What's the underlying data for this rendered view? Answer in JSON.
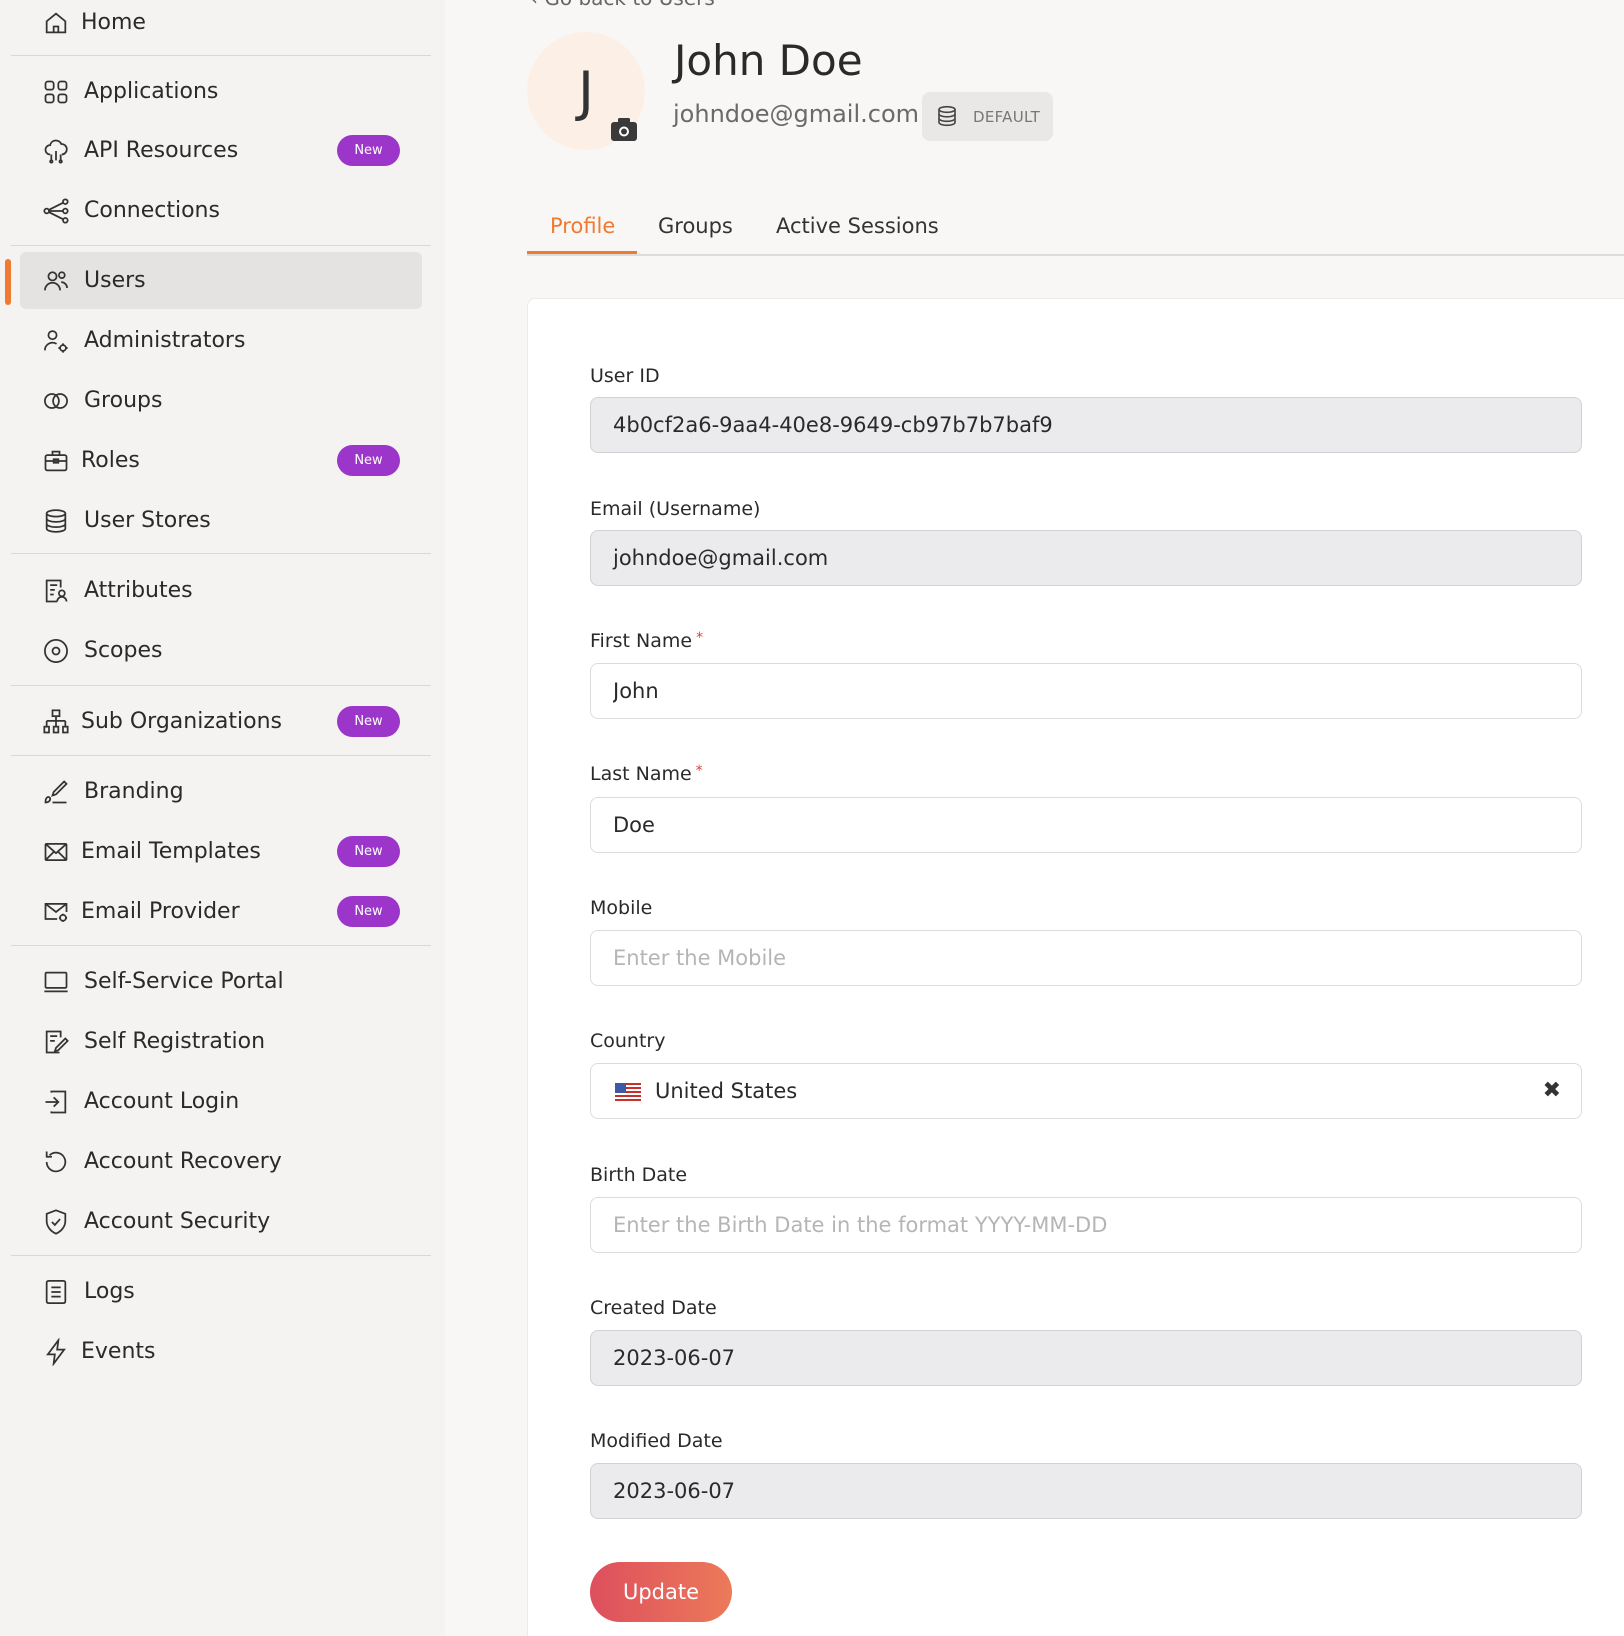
{
  "sidebar": {
    "items": [
      {
        "label": "Home",
        "icon": "home-icon"
      },
      {
        "label": "Applications",
        "icon": "applications-icon"
      },
      {
        "label": "API Resources",
        "icon": "api-resources-icon",
        "badge": "New"
      },
      {
        "label": "Connections",
        "icon": "connections-icon"
      },
      {
        "label": "Users",
        "icon": "users-icon",
        "active": true
      },
      {
        "label": "Administrators",
        "icon": "administrators-icon"
      },
      {
        "label": "Groups",
        "icon": "groups-icon"
      },
      {
        "label": "Roles",
        "icon": "roles-icon",
        "badge": "New"
      },
      {
        "label": "User Stores",
        "icon": "user-stores-icon"
      },
      {
        "label": "Attributes",
        "icon": "attributes-icon"
      },
      {
        "label": "Scopes",
        "icon": "scopes-icon"
      },
      {
        "label": "Sub Organizations",
        "icon": "sub-organizations-icon",
        "badge": "New"
      },
      {
        "label": "Branding",
        "icon": "branding-icon"
      },
      {
        "label": "Email Templates",
        "icon": "email-templates-icon",
        "badge": "New"
      },
      {
        "label": "Email Provider",
        "icon": "email-provider-icon",
        "badge": "New"
      },
      {
        "label": "Self-Service Portal",
        "icon": "self-service-portal-icon"
      },
      {
        "label": "Self Registration",
        "icon": "self-registration-icon"
      },
      {
        "label": "Account Login",
        "icon": "account-login-icon"
      },
      {
        "label": "Account Recovery",
        "icon": "account-recovery-icon"
      },
      {
        "label": "Account Security",
        "icon": "account-security-icon"
      },
      {
        "label": "Logs",
        "icon": "logs-icon"
      },
      {
        "label": "Events",
        "icon": "events-icon"
      }
    ]
  },
  "header": {
    "back_label": "Go back to Users",
    "avatar_initial": "J",
    "name": "John Doe",
    "email": "johndoe@gmail.com",
    "user_store": "DEFAULT"
  },
  "tabs": [
    "Profile",
    "Groups",
    "Active Sessions"
  ],
  "form": {
    "user_id_label": "User ID",
    "user_id_value": "4b0cf2a6-9aa4-40e8-9649-cb97b7b7baf9",
    "email_label": "Email (Username)",
    "email_value": "johndoe@gmail.com",
    "first_name_label": "First Name",
    "first_name_value": "John",
    "last_name_label": "Last Name",
    "last_name_value": "Doe",
    "required_mark": "*",
    "mobile_label": "Mobile",
    "mobile_placeholder": "Enter the Mobile",
    "country_label": "Country",
    "country_value": "United States",
    "clear_glyph": "✖",
    "birth_date_label": "Birth Date",
    "birth_date_placeholder": "Enter the Birth Date in the format YYYY-MM-DD",
    "created_date_label": "Created Date",
    "created_date_value": "2023-06-07",
    "modified_date_label": "Modified Date",
    "modified_date_value": "2023-06-07",
    "update_label": "Update"
  },
  "colors": {
    "accent": "#f07a31",
    "badge": "#9c35c9",
    "update_gradient_start": "#dd4f5d",
    "update_gradient_end": "#ec7a5a"
  }
}
